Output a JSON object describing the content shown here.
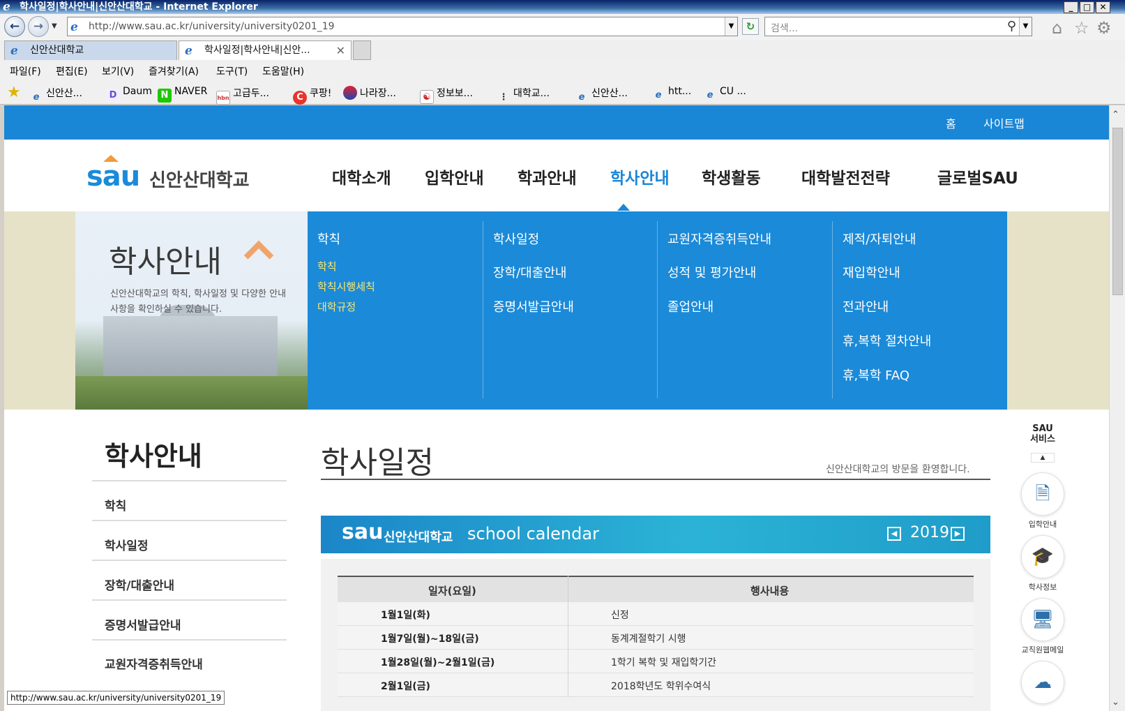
{
  "window": {
    "title": "학사일정|학사안내|신안산대학교 - Internet Explorer"
  },
  "address": {
    "url": "http://www.sau.ac.kr/university/university0201_19"
  },
  "search": {
    "placeholder": "검색..."
  },
  "tabs": [
    {
      "label": "신안산대학교"
    },
    {
      "label": "학사일정|학사안내|신안..."
    }
  ],
  "menu": [
    "파일(F)",
    "편집(E)",
    "보기(V)",
    "즐겨찾기(A)",
    "도구(T)",
    "도움말(H)"
  ],
  "favorites": [
    {
      "label": "신안산..."
    },
    {
      "label": "Daum"
    },
    {
      "label": "NAVER"
    },
    {
      "label": "고급두..."
    },
    {
      "label": "쿠팡!"
    },
    {
      "label": "나라장..."
    },
    {
      "label": "정보보..."
    },
    {
      "label": "대학교..."
    },
    {
      "label": "신안산..."
    },
    {
      "label": "htt..."
    },
    {
      "label": "CU ..."
    }
  ],
  "site": {
    "top_links": [
      "홈",
      "사이트맵"
    ],
    "logo": {
      "mark": "sau",
      "name": "신안산대학교"
    },
    "gnb": [
      "대학소개",
      "입학안내",
      "학과안내",
      "학사안내",
      "학생활동",
      "대학발전전략",
      "글로벌SAU"
    ],
    "hero": {
      "title": "학사안내",
      "desc": "신안산대학교의 학칙, 학사일정 및 다양한 안내사항을 확인하실 수 있습니다."
    },
    "mega": {
      "col1": {
        "head": "학칙",
        "subs": [
          "학칙",
          "학칙시행세칙",
          "대학규정"
        ]
      },
      "col2": {
        "head": "학사일정",
        "items": [
          "장학/대출안내",
          "증명서발급안내"
        ]
      },
      "col3": {
        "head": "교원자격증취득안내",
        "items": [
          "성적 및 평가안내",
          "졸업안내"
        ]
      },
      "col4": {
        "head": "제적/자퇴안내",
        "items": [
          "재입학안내",
          "전과안내",
          "휴,복학 절차안내",
          "휴,복학 FAQ"
        ]
      }
    },
    "lnb": {
      "title": "학사안내",
      "items": [
        "학칙",
        "학사일정",
        "장학/대출안내",
        "증명서발급안내",
        "교원자격증취득안내"
      ]
    },
    "page": {
      "title": "학사일정",
      "welcome": "신안산대학교의 방문을 환영합니다."
    },
    "calendar": {
      "brand": "sau",
      "brand_name": "신안산대학교",
      "label": "school calendar",
      "year": "2019",
      "headers": [
        "일자(요일)",
        "행사내용"
      ],
      "rows": [
        {
          "date": "1월1일(화)",
          "event": "신정"
        },
        {
          "date": "1월7일(월)~18일(금)",
          "event": "동계계절학기 시행"
        },
        {
          "date": "1월28일(월)~2월1일(금)",
          "event": "1학기 복학 및 재입학기간"
        },
        {
          "date": "2월1일(금)",
          "event": "2018학년도 학위수여식"
        }
      ]
    },
    "quick": {
      "title": "SAU\n서비스",
      "items": [
        "입학안내",
        "학사정보",
        "교직원웹메일"
      ]
    }
  },
  "status": {
    "hover_url": "http://www.sau.ac.kr/university/university0201_19"
  }
}
